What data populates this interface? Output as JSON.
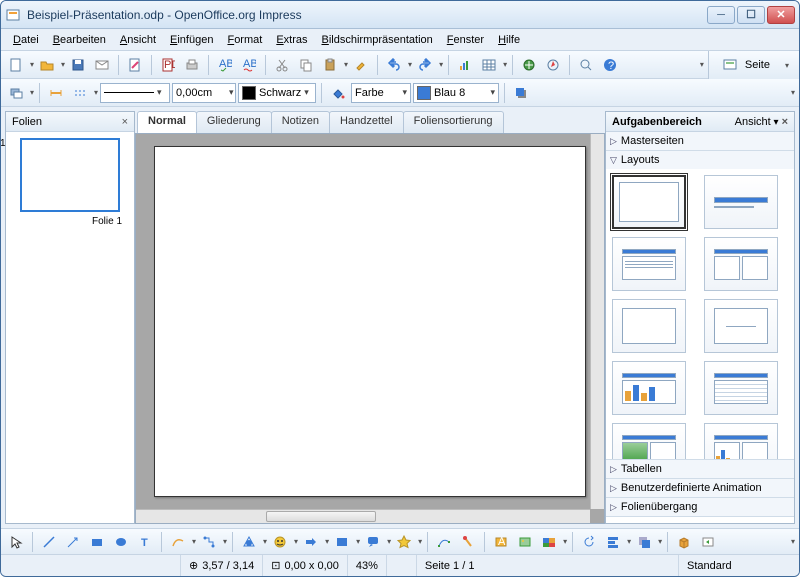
{
  "window": {
    "title": "Beispiel-Präsentation.odp - OpenOffice.org Impress"
  },
  "menu": [
    "Datei",
    "Bearbeiten",
    "Ansicht",
    "Einfügen",
    "Format",
    "Extras",
    "Bildschirmpräsentation",
    "Fenster",
    "Hilfe"
  ],
  "toolbar2": {
    "width_value": "0,00cm",
    "line_color_label": "Schwarz",
    "line_color_hex": "#000000",
    "fill_mode": "Farbe",
    "fill_color_label": "Blau 8",
    "fill_color_hex": "#3a7bd5"
  },
  "page_toolbar_label": "Seite",
  "slides_panel": {
    "title": "Folien",
    "items": [
      {
        "num": "1",
        "label": "Folie 1"
      }
    ]
  },
  "tabs": [
    "Normal",
    "Gliederung",
    "Notizen",
    "Handzettel",
    "Foliensortierung"
  ],
  "active_tab": 0,
  "taskpane": {
    "title": "Aufgabenbereich",
    "view_label": "Ansicht",
    "sections": {
      "master": "Masterseiten",
      "layouts": "Layouts",
      "tables": "Tabellen",
      "custom_anim": "Benutzerdefinierte Animation",
      "transition": "Folienübergang"
    }
  },
  "status": {
    "pos": "3,57 / 3,14",
    "size": "0,00 x 0,00",
    "zoom": "43%",
    "page": "Seite 1 / 1",
    "mode": "Standard"
  }
}
